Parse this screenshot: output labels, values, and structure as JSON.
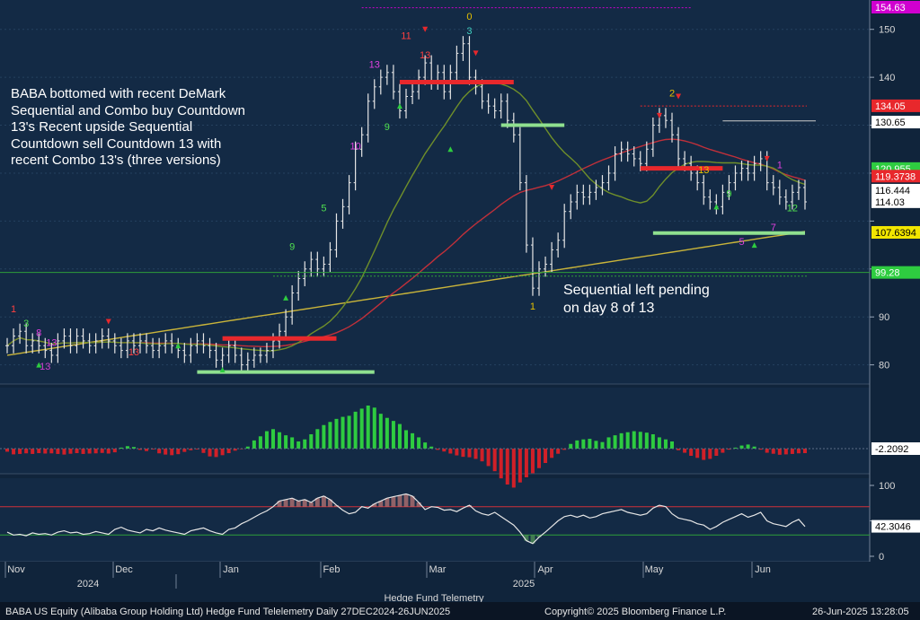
{
  "annotations": {
    "left": "BABA bottomed with recent DeMark Sequential and Combo buy Countdown 13's Recent upside Sequential Countdown sell Countdown 13 with recent Combo 13's (three versions)",
    "right": "Sequential left pending on day 8 of 13"
  },
  "footer": {
    "security": "BABA US Equity (Alibaba Group Holding Ltd) Hedge Fund Telelemetry  Daily 27DEC2024-26JUN2025",
    "copyright": "Copyright© 2025 Bloomberg Finance L.P.",
    "timestamp": "26-Jun-2025 13:28:05"
  },
  "chart_data": [
    {
      "type": "candlestick",
      "panel": "price",
      "y_ticks": [
        80,
        90,
        100,
        110,
        120,
        130,
        140,
        150
      ],
      "y_tick_labels": [
        "80",
        "90",
        "",
        "",
        "",
        "",
        "140",
        "150"
      ],
      "ylim": [
        76,
        155
      ],
      "price_labels": [
        {
          "text": "154.63",
          "value": 154.63,
          "color": "#d000d0"
        },
        {
          "text": "134.05",
          "value": 134.05,
          "color": "#e8282c"
        },
        {
          "text": "130.65",
          "value": 130.65,
          "color": "#ffffff"
        },
        {
          "text": "120.955",
          "value": 120.955,
          "color": "#2ecc40"
        },
        {
          "text": "119.3738",
          "value": 119.3738,
          "color": "#e8282c"
        },
        {
          "text": "116.444",
          "value": 116.444,
          "color": "#ffffff"
        },
        {
          "text": "114.03",
          "value": 114.03,
          "color": "#ffffff"
        },
        {
          "text": "107.6394",
          "value": 107.6394,
          "color": "#f2e600"
        },
        {
          "text": "99.28",
          "value": 99.28,
          "color": "#2ecc40"
        }
      ],
      "x_month_labels": [
        "Nov",
        "Dec",
        "Jan",
        "Feb",
        "Mar",
        "Apr",
        "May",
        "Jun"
      ],
      "x_year_labels": [
        "2024",
        "2025"
      ],
      "xlabel": "Hedge Fund Telemetry",
      "close_series": [
        84,
        86,
        87,
        84,
        85,
        84,
        83,
        82,
        85,
        86,
        84,
        86,
        85,
        84,
        85,
        86,
        85,
        84,
        83,
        85,
        84,
        85,
        84,
        83,
        84,
        85,
        84,
        83,
        82,
        84,
        85,
        84,
        83,
        81,
        82,
        84,
        82,
        80,
        81,
        82,
        82,
        83,
        85,
        87,
        90,
        95,
        98,
        100,
        102,
        100,
        101,
        104,
        110,
        113,
        118,
        125,
        128,
        135,
        138,
        140,
        141,
        137,
        133,
        136,
        137,
        140,
        143,
        139,
        141,
        137,
        141,
        145,
        147,
        140,
        138,
        135,
        134,
        133,
        135,
        131,
        128,
        118,
        105,
        96,
        100,
        101,
        104,
        106,
        112,
        114,
        116,
        115,
        116,
        117,
        118,
        120,
        124,
        125,
        124,
        123,
        122,
        125,
        130,
        132,
        131,
        128,
        123,
        122,
        120,
        118,
        115,
        114,
        113,
        116,
        118,
        120,
        121,
        120,
        122,
        123,
        118,
        117,
        115,
        114,
        116,
        117,
        114
      ]
    },
    {
      "type": "bar",
      "panel": "oscillator",
      "value_label": "-2.2092",
      "value": -2.2092,
      "values": [
        -1.5,
        -2.8,
        -2.6,
        -2.3,
        -2.6,
        -2.2,
        -2.4,
        -2.3,
        -2.6,
        -2.9,
        -2.5,
        -2.2,
        -2.6,
        -2.4,
        -2.3,
        -2.1,
        -2.4,
        -1.8,
        0.5,
        1.2,
        0.8,
        -0.6,
        -1.2,
        -0.4,
        -2.3,
        -2.9,
        -3.2,
        -2.7,
        -1.6,
        -0.8,
        -0.4,
        -2.1,
        -3.8,
        -4.1,
        -3.2,
        -2.2,
        -1.0,
        -0.3,
        1.0,
        4.0,
        6.0,
        8.5,
        9.5,
        8.0,
        6.5,
        5.5,
        3.5,
        4.5,
        7.0,
        9.5,
        11.5,
        13.0,
        14.5,
        15.5,
        16.0,
        18.0,
        19.5,
        21.0,
        20.0,
        17.0,
        15.0,
        13.5,
        12.0,
        9.0,
        7.5,
        5.5,
        3.0,
        1.0,
        -0.6,
        -1.4,
        -2.4,
        -3.3,
        -4.0,
        -4.2,
        -5.0,
        -6.2,
        -8.5,
        -11.0,
        -14.5,
        -17.5,
        -19.0,
        -16.5,
        -14.0,
        -12.0,
        -9.5,
        -7.0,
        -4.5,
        -2.5,
        -0.6,
        2.3,
        4.0,
        4.5,
        4.8,
        3.8,
        3.2,
        5.5,
        6.5,
        7.5,
        8.0,
        8.5,
        8.2,
        7.8,
        7.0,
        5.5,
        4.5,
        3.5,
        -0.8,
        -2.0,
        -3.5,
        -4.5,
        -5.5,
        -5.0,
        -3.5,
        -2.0,
        -0.5,
        0.5,
        1.5,
        2.0,
        1.0,
        -0.5,
        -2.0,
        -2.5,
        -3.0,
        -2.8,
        -2.6,
        -2.3,
        -2.2
      ]
    },
    {
      "type": "line",
      "panel": "rsi",
      "value_label": "42.3046",
      "value": 42.3046,
      "y_ticks": [
        0,
        50,
        100
      ],
      "y_tick_labels": [
        "0",
        "",
        "100"
      ],
      "upper_band": 70,
      "lower_band": 30,
      "values": [
        34,
        30,
        31,
        29,
        33,
        31,
        32,
        30,
        34,
        36,
        33,
        34,
        31,
        32,
        35,
        33,
        31,
        38,
        41,
        37,
        35,
        33,
        38,
        36,
        40,
        37,
        35,
        33,
        31,
        36,
        38,
        40,
        36,
        33,
        31,
        38,
        40,
        46,
        50,
        55,
        60,
        64,
        70,
        78,
        80,
        82,
        78,
        80,
        76,
        82,
        85,
        80,
        72,
        65,
        60,
        62,
        70,
        68,
        74,
        78,
        82,
        84,
        86,
        88,
        85,
        76,
        66,
        70,
        69,
        65,
        66,
        63,
        68,
        72,
        64,
        60,
        58,
        62,
        56,
        50,
        44,
        34,
        22,
        18,
        27,
        34,
        42,
        50,
        56,
        58,
        55,
        58,
        54,
        56,
        60,
        62,
        64,
        66,
        62,
        60,
        58,
        60,
        68,
        72,
        70,
        60,
        54,
        52,
        50,
        46,
        44,
        38,
        42,
        48,
        52,
        56,
        60,
        55,
        58,
        62,
        50,
        46,
        44,
        42,
        48,
        52,
        42
      ]
    }
  ]
}
